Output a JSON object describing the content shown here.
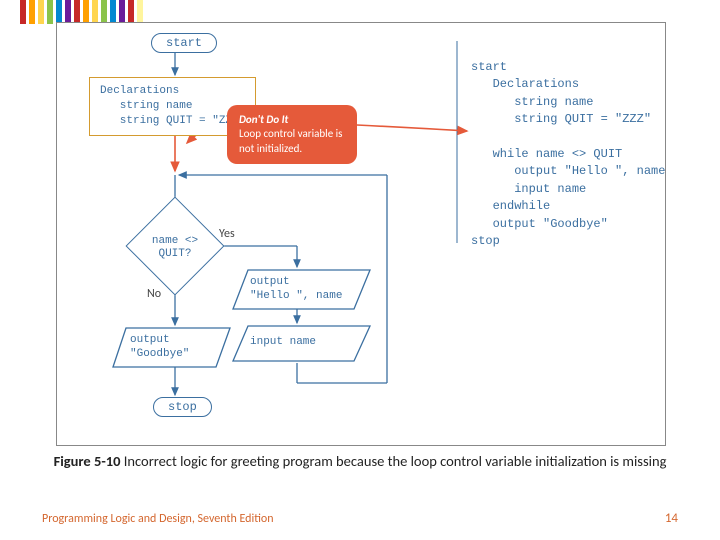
{
  "stripes": [
    "#c62828",
    "#ffa000",
    "#ffd54f",
    "#8bc34a",
    "#0288d1",
    "#6a1b9a",
    "#c62828",
    "#ffa000",
    "#ffd54f",
    "#8bc34a",
    "#0288d1",
    "#6a1b9a",
    "#c62828",
    "#fff59d"
  ],
  "flowchart": {
    "start": "start",
    "declarations": "Declarations\n   string name\n   string QUIT = \"ZZZ\"",
    "callout_title": "Don't Do It",
    "callout_body": "Loop control variable is not initialized.",
    "decision": "name <>\nQUIT?",
    "yes": "Yes",
    "no": "No",
    "out_hello": "output\n\"Hello \", name",
    "input_name": "input name",
    "out_goodbye": "output\n\"Goodbye\"",
    "stop": "stop"
  },
  "pseudocode": "start\n   Declarations\n      string name\n      string QUIT = \"ZZZ\"\n\n   while name <> QUIT\n      output \"Hello \", name\n      input name\n   endwhile\n   output \"Goodbye\"\nstop",
  "caption_bold": "Figure 5-10",
  "caption_rest": " Incorrect logic for greeting program because the loop control variable initialization is missing",
  "footer_left": "Programming Logic and Design, Seventh Edition",
  "footer_right": "14"
}
